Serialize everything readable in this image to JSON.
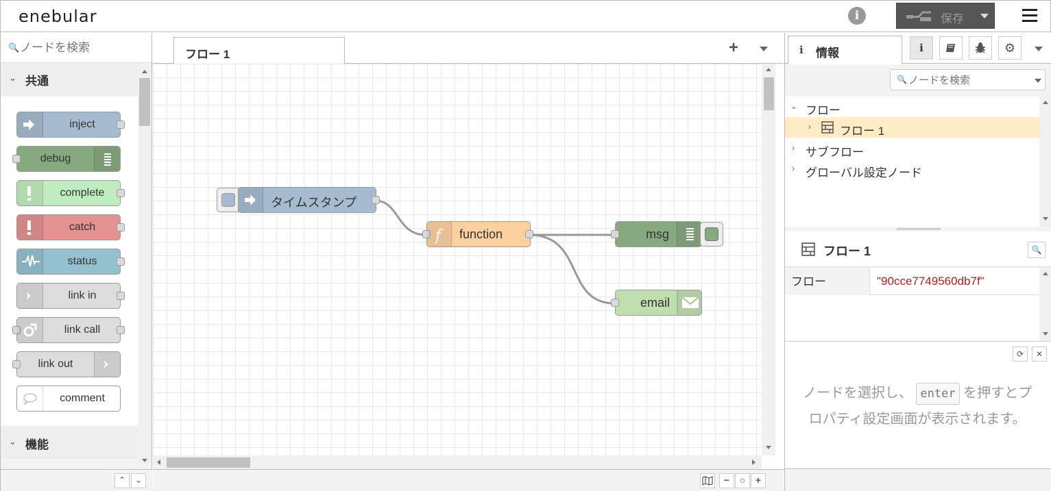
{
  "header": {
    "logo": "enebular",
    "save_label": "保存"
  },
  "palette": {
    "search_placeholder": "ノードを検索",
    "categories": [
      "共通",
      "機能"
    ],
    "nodes": [
      {
        "label": "inject",
        "color": "#a6bbcf"
      },
      {
        "label": "debug",
        "color": "#87a980"
      },
      {
        "label": "complete",
        "color": "#c0edc0"
      },
      {
        "label": "catch",
        "color": "#e49191"
      },
      {
        "label": "status",
        "color": "#94c1d0"
      },
      {
        "label": "link in",
        "color": "#dddddd"
      },
      {
        "label": "link call",
        "color": "#dddddd"
      },
      {
        "label": "link out",
        "color": "#dddddd"
      },
      {
        "label": "comment",
        "color": "#ffffff"
      }
    ]
  },
  "workspace": {
    "tab_label": "フロー 1",
    "nodes": {
      "inject": "タイムスタンプ",
      "function": "function",
      "debug": "msg",
      "email": "email"
    }
  },
  "sidebar": {
    "tab_label": "情報",
    "search_placeholder": "ノードを検索",
    "tree": {
      "flows": "フロー",
      "flow1": "フロー 1",
      "subflows": "サブフロー",
      "global": "グローバル設定ノード"
    },
    "properties": {
      "title": "フロー 1",
      "key": "フロー",
      "value": "\"90cce7749560db7f\""
    },
    "help": {
      "before": "ノードを選択し、",
      "key": "enter",
      "after": "を押すとプロパティ設定画面が表示されます。"
    }
  }
}
